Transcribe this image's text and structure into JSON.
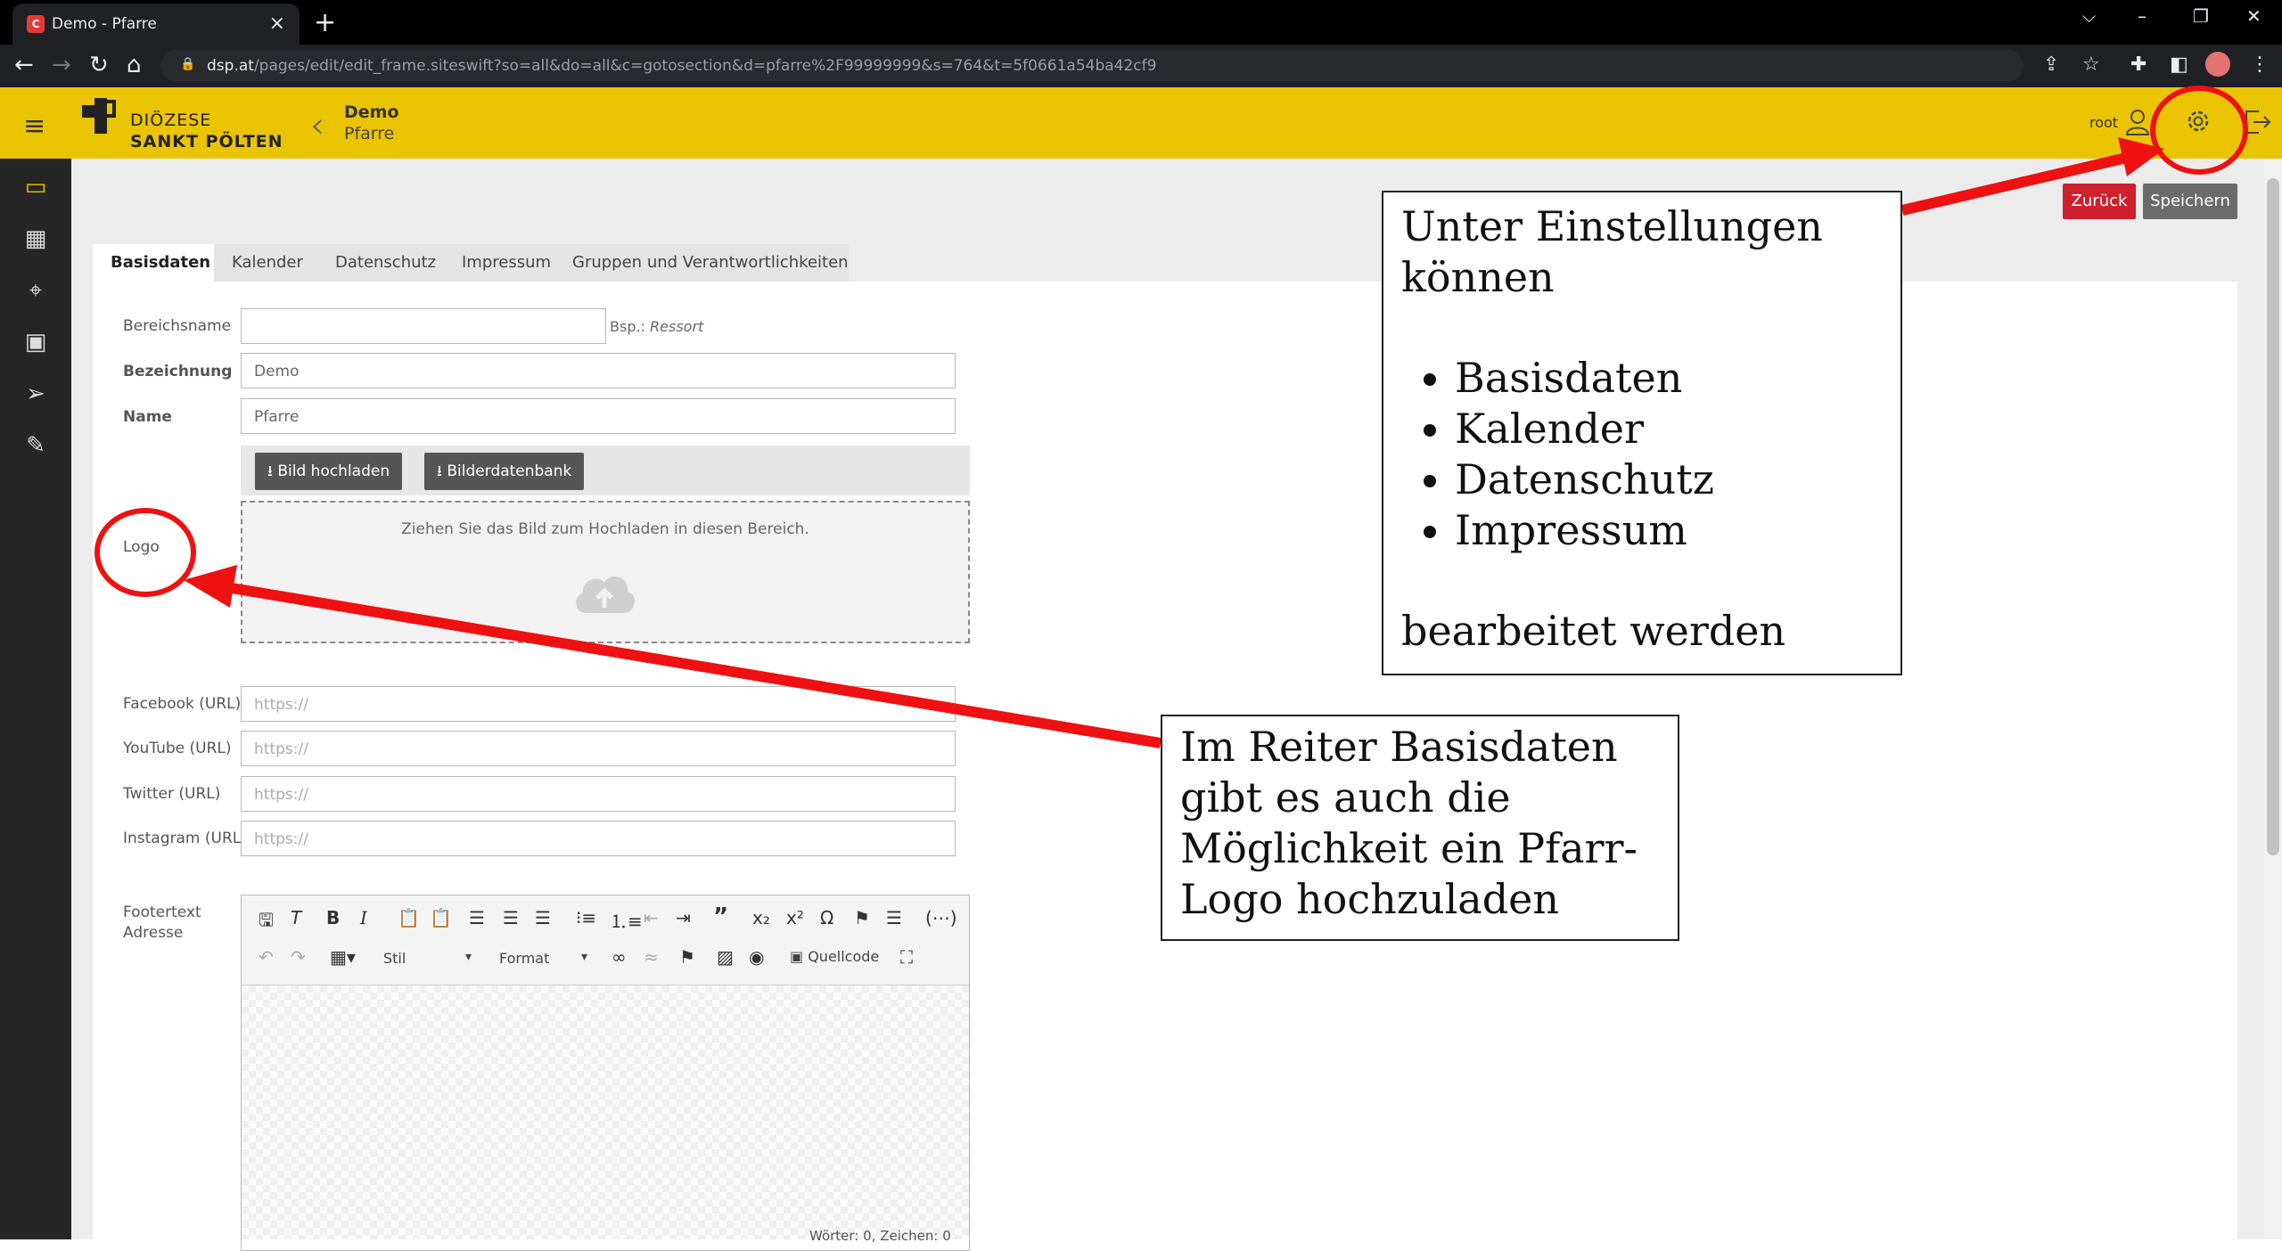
{
  "browser": {
    "tab_title": "Demo - Pfarre",
    "tab_favicon": "C",
    "url_host": "dsp.at",
    "url_path": "/pages/edit/edit_frame.siteswift?so=all&do=all&c=gotosection&d=pfarre%2F99999999&s=764&t=5f0661a54ba42cf9",
    "icons": [
      "back-icon",
      "forward-icon",
      "reload-icon",
      "home-icon",
      "lock-icon",
      "share-icon",
      "star-icon",
      "extensions-icon",
      "sidepanel-icon",
      "profile-icon",
      "menu-icon"
    ]
  },
  "header": {
    "logo_line1": "DIÖZESE",
    "logo_line2": "SANKT PÖLTEN",
    "breadcrumb_title": "Demo",
    "breadcrumb_sub": "Pfarre",
    "user": "root",
    "brand_color": "#ebc400"
  },
  "actions": {
    "back_label": "Zurück",
    "save_label": "Speichern"
  },
  "tabs": [
    "Basisdaten",
    "Kalender",
    "Datenschutz",
    "Impressum",
    "Gruppen und Verantwortlichkeiten"
  ],
  "form": {
    "bereichsname_label": "Bereichsname",
    "bereichsname_value": "",
    "bereichsname_hint_prefix": "Bsp.: ",
    "bereichsname_hint_example": "Ressort",
    "bezeichnung_label": "Bezeichnung",
    "bezeichnung_value": "Demo",
    "name_label": "Name",
    "name_value": "Pfarre",
    "logo_label": "Logo",
    "upload_button": "Bild hochladen",
    "library_button": "Bilderdatenbank",
    "dropzone_text": "Ziehen Sie das Bild zum Hochladen in diesen Bereich.",
    "facebook_label": "Facebook (URL)",
    "youtube_label": "YouTube (URL)",
    "twitter_label": "Twitter (URL)",
    "instagram_label": "Instagram (URL)",
    "url_placeholder": "https://",
    "footer_label_1": "Footertext",
    "footer_label_2": "Adresse",
    "style_select": "Stil",
    "format_select": "Format",
    "source_button": "Quellcode",
    "word_count": "Wörter: 0, Zeichen: 0"
  },
  "annotations": {
    "callout_settings_line1": "Unter Einstellungen",
    "callout_settings_line2": "können",
    "callout_settings_items": [
      "Basisdaten",
      "Kalender",
      "Datenschutz",
      "Impressum"
    ],
    "callout_settings_tail": "bearbeitet werden",
    "callout_logo": "Im Reiter Basisdaten gibt es auch die Möglichkeit ein Pfarr-Logo hochzuladen",
    "accent_color": "#ee1111"
  }
}
